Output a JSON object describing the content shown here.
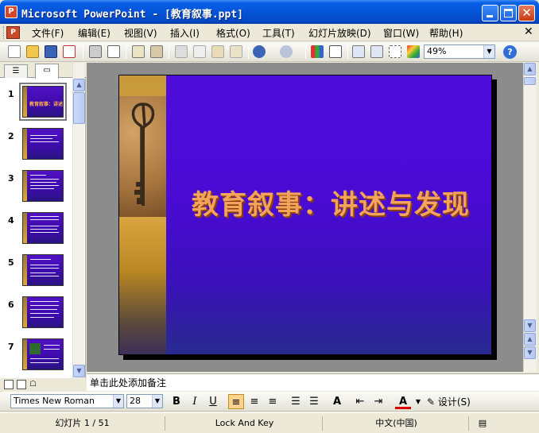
{
  "window": {
    "title": "Microsoft PowerPoint - [教育叙事.ppt]"
  },
  "menu": {
    "items": [
      "文件(F)",
      "编辑(E)",
      "视图(V)",
      "插入(I)",
      "格式(O)",
      "工具(T)",
      "幻灯片放映(D)",
      "窗口(W)",
      "帮助(H)"
    ]
  },
  "toolbar": {
    "zoom": "49%"
  },
  "slides": {
    "count_visible": 7,
    "numbers": [
      "1",
      "2",
      "3",
      "4",
      "5",
      "6",
      "7"
    ],
    "current": 1,
    "thumb1_title": "教育叙事：讲述与发现"
  },
  "slide": {
    "title": "教育叙事：讲述与发现"
  },
  "notes": {
    "placeholder": "单击此处添加备注"
  },
  "format": {
    "font_name": "Times New Roman",
    "font_size": "28",
    "design_label": "设计(S)"
  },
  "status": {
    "slide_position": "幻灯片 1 / 51",
    "template": "Lock And Key",
    "language": "中文(中国)"
  },
  "colors": {
    "title_bar": "#0453d8",
    "slide_bg": "#4e0cda",
    "title_text": "#f3a35b"
  }
}
